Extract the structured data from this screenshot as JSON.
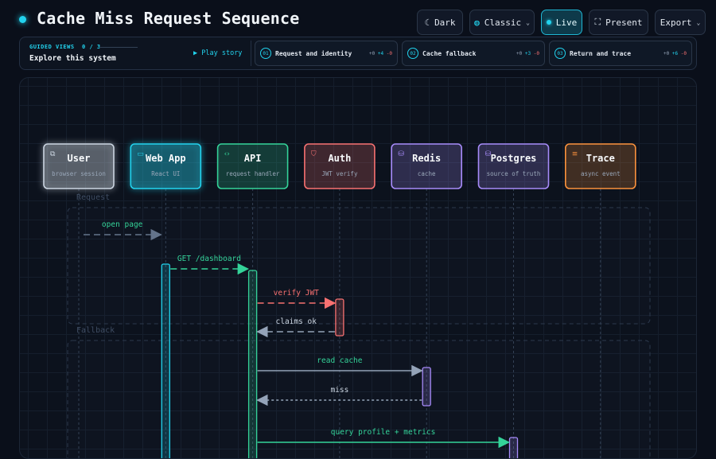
{
  "title": "Cache Miss Request Sequence",
  "toolbar": [
    {
      "id": "theme",
      "label": "Dark",
      "icon": "moon-icon"
    },
    {
      "id": "style",
      "label": "Classic",
      "icon": "palette-icon",
      "dropdown": true
    },
    {
      "id": "live",
      "label": "Live",
      "icon": "live-dot",
      "active": true
    },
    {
      "id": "present",
      "label": "Present",
      "icon": "fullscreen-icon"
    },
    {
      "id": "export",
      "label": "Export",
      "dropdown": true
    }
  ],
  "guided": {
    "label": "GUIDED VIEWS",
    "progress": "0 / 3",
    "title": "Explore this system",
    "play": "Play story",
    "steps": [
      {
        "num": "01",
        "label": "Request and identity",
        "a": "+0",
        "b": "+4",
        "c": "-0"
      },
      {
        "num": "02",
        "label": "Cache fallback",
        "a": "+0",
        "b": "+3",
        "c": "-0"
      },
      {
        "num": "03",
        "label": "Return and trace",
        "a": "+0",
        "b": "+6",
        "c": "-0"
      }
    ]
  },
  "actors": [
    {
      "id": "user",
      "name": "User",
      "sub": "browser session",
      "color": "#cbd5e1",
      "icon": "external-link-icon"
    },
    {
      "id": "webapp",
      "name": "Web App",
      "sub": "React UI",
      "color": "#22d3ee",
      "icon": "window-icon"
    },
    {
      "id": "api",
      "name": "API",
      "sub": "request handler",
      "color": "#34d399",
      "icon": "code-icon"
    },
    {
      "id": "auth",
      "name": "Auth",
      "sub": "JWT verify",
      "color": "#f87171",
      "icon": "shield-icon"
    },
    {
      "id": "redis",
      "name": "Redis",
      "sub": "cache",
      "color": "#a78bfa",
      "icon": "database-icon"
    },
    {
      "id": "postgres",
      "name": "Postgres",
      "sub": "source of truth",
      "color": "#a78bfa",
      "icon": "database-icon"
    },
    {
      "id": "trace",
      "name": "Trace",
      "sub": "async event",
      "color": "#fb923c",
      "icon": "menu-icon"
    }
  ],
  "groups": [
    {
      "label": "Request"
    },
    {
      "label": "Fallback"
    }
  ],
  "messages": [
    {
      "from": "user",
      "to": "webapp",
      "label": "open page",
      "style": "dashed",
      "color": "#64748b",
      "labelColor": "#34d399"
    },
    {
      "from": "webapp",
      "to": "api",
      "label": "GET /dashboard",
      "style": "dashed",
      "color": "#34d399",
      "labelColor": "#34d399"
    },
    {
      "from": "api",
      "to": "auth",
      "label": "verify JWT",
      "style": "dashed",
      "color": "#f87171",
      "labelColor": "#f87171"
    },
    {
      "from": "auth",
      "to": "api",
      "label": "claims ok",
      "style": "dashed",
      "color": "#94a3b8",
      "labelColor": "#cbd5e1"
    },
    {
      "from": "api",
      "to": "redis",
      "label": "read cache",
      "style": "solid",
      "color": "#94a3b8",
      "labelColor": "#34d399"
    },
    {
      "from": "redis",
      "to": "api",
      "label": "miss",
      "style": "dotted",
      "color": "#94a3b8",
      "labelColor": "#cbd5e1"
    },
    {
      "from": "api",
      "to": "postgres",
      "label": "query profile + metrics",
      "style": "solid",
      "color": "#34d399",
      "labelColor": "#34d399"
    }
  ]
}
